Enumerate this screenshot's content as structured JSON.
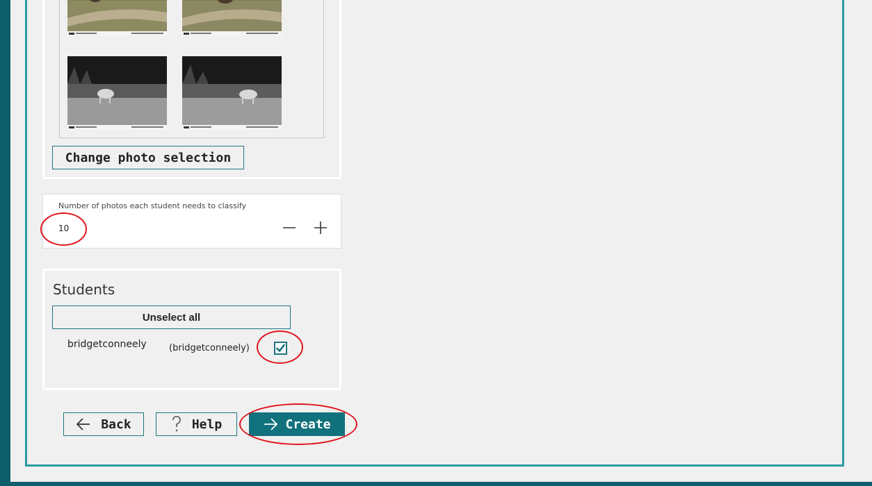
{
  "photos": {
    "change_label": "Change photo selection",
    "items": [
      "photo-day-1",
      "photo-day-2",
      "photo-night-1",
      "photo-night-2"
    ]
  },
  "counter": {
    "label": "Number of photos each student needs to classify",
    "value": "10",
    "minus_icon": "minus-icon",
    "plus_icon": "plus-icon"
  },
  "students": {
    "title": "Students",
    "unselect_label": "Unselect all",
    "list": [
      {
        "name": "bridgetconneely",
        "handle": "(bridgetconneely)",
        "checked": true
      }
    ]
  },
  "actions": {
    "back_label": "Back",
    "help_label": "Help",
    "create_label": "Create"
  },
  "colors": {
    "accent": "#11717c",
    "outer": "#0d5d6a",
    "frame": "#2a9ba2",
    "annotation": "#e0141c"
  }
}
